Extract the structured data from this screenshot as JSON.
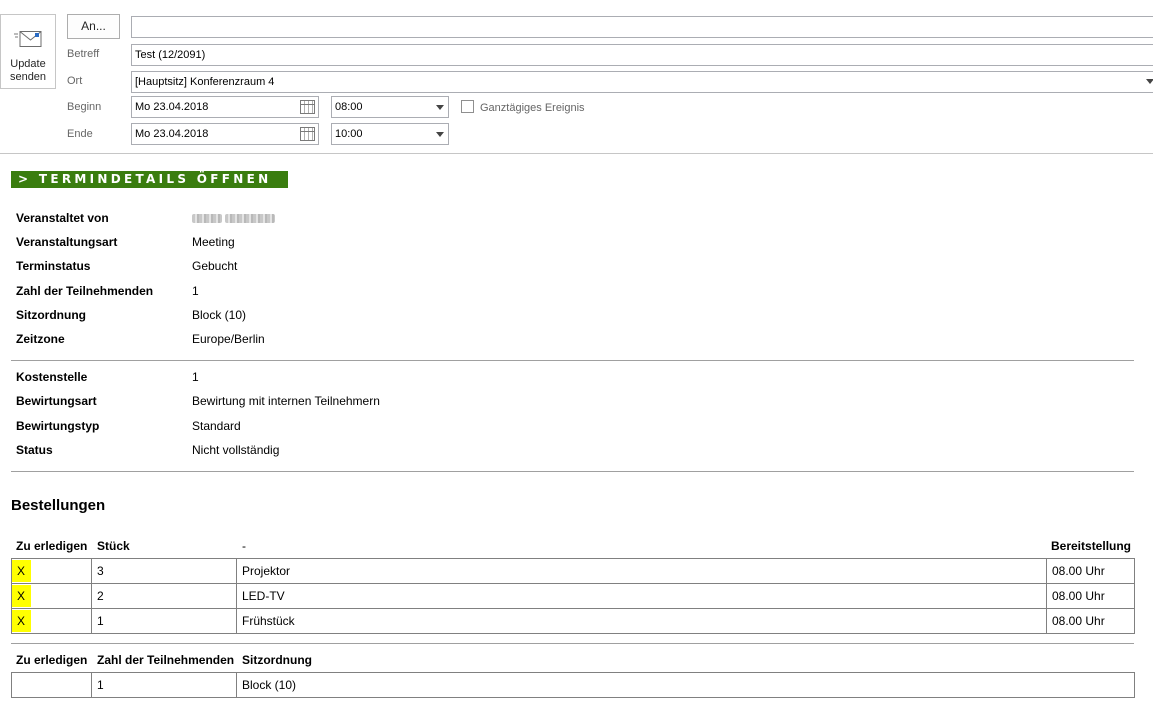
{
  "header": {
    "send_button": {
      "line1": "Update",
      "line2": "senden",
      "icon": "envelope-send-icon"
    },
    "to_button": "An...",
    "to_value": "",
    "subject_label": "Betreff",
    "subject_value": "Test (12/2091)",
    "location_label": "Ort",
    "location_value": "[Hauptsitz] Konferenzraum 4",
    "start_label": "Beginn",
    "start_date": "Mo 23.04.2018",
    "start_time": "08:00",
    "end_label": "Ende",
    "end_date": "Mo 23.04.2018",
    "end_time": "10:00",
    "allday_label": "Ganztägiges Ereignis",
    "allday_checked": false
  },
  "banner": "> TERMINDETAILS ÖFFNEN",
  "details": [
    {
      "key": "Veranstaltet von",
      "value": ""
    },
    {
      "key": "Veranstaltungsart",
      "value": "Meeting"
    },
    {
      "key": "Terminstatus",
      "value": "Gebucht"
    },
    {
      "key": "Zahl der Teilnehmenden",
      "value": "1"
    },
    {
      "key": "Sitzordnung",
      "value": "Block (10)"
    },
    {
      "key": "Zeitzone",
      "value": "Europe/Berlin"
    }
  ],
  "catering": [
    {
      "key": "Kostenstelle",
      "value": "1"
    },
    {
      "key": "Bewirtungsart",
      "value": "Bewirtung mit internen Teilnehmern"
    },
    {
      "key": "Bewirtungstyp",
      "value": "Standard"
    },
    {
      "key": "Status",
      "value": "Nicht vollständig"
    }
  ],
  "orders": {
    "title": "Bestellungen",
    "headers": [
      "Zu erledigen",
      "Stück",
      "-",
      "Bereitstellung"
    ],
    "rows": [
      {
        "todo": "X",
        "qty": "3",
        "item": "Projektor",
        "time": "08.00 Uhr"
      },
      {
        "todo": "X",
        "qty": "2",
        "item": "LED-TV",
        "time": "08.00 Uhr"
      },
      {
        "todo": "X",
        "qty": "1",
        "item": "Frühstück",
        "time": "08.00 Uhr"
      }
    ],
    "highlight_color": "#ffff00"
  },
  "seating": {
    "headers": [
      "Zu erledigen",
      "Zahl der Teilnehmenden",
      "Sitzordnung"
    ],
    "rows": [
      {
        "todo": "",
        "participants": "1",
        "seating": "Block (10)"
      }
    ]
  },
  "colors": {
    "banner_bg": "#3a7d0f",
    "banner_text": "#ffffff"
  }
}
